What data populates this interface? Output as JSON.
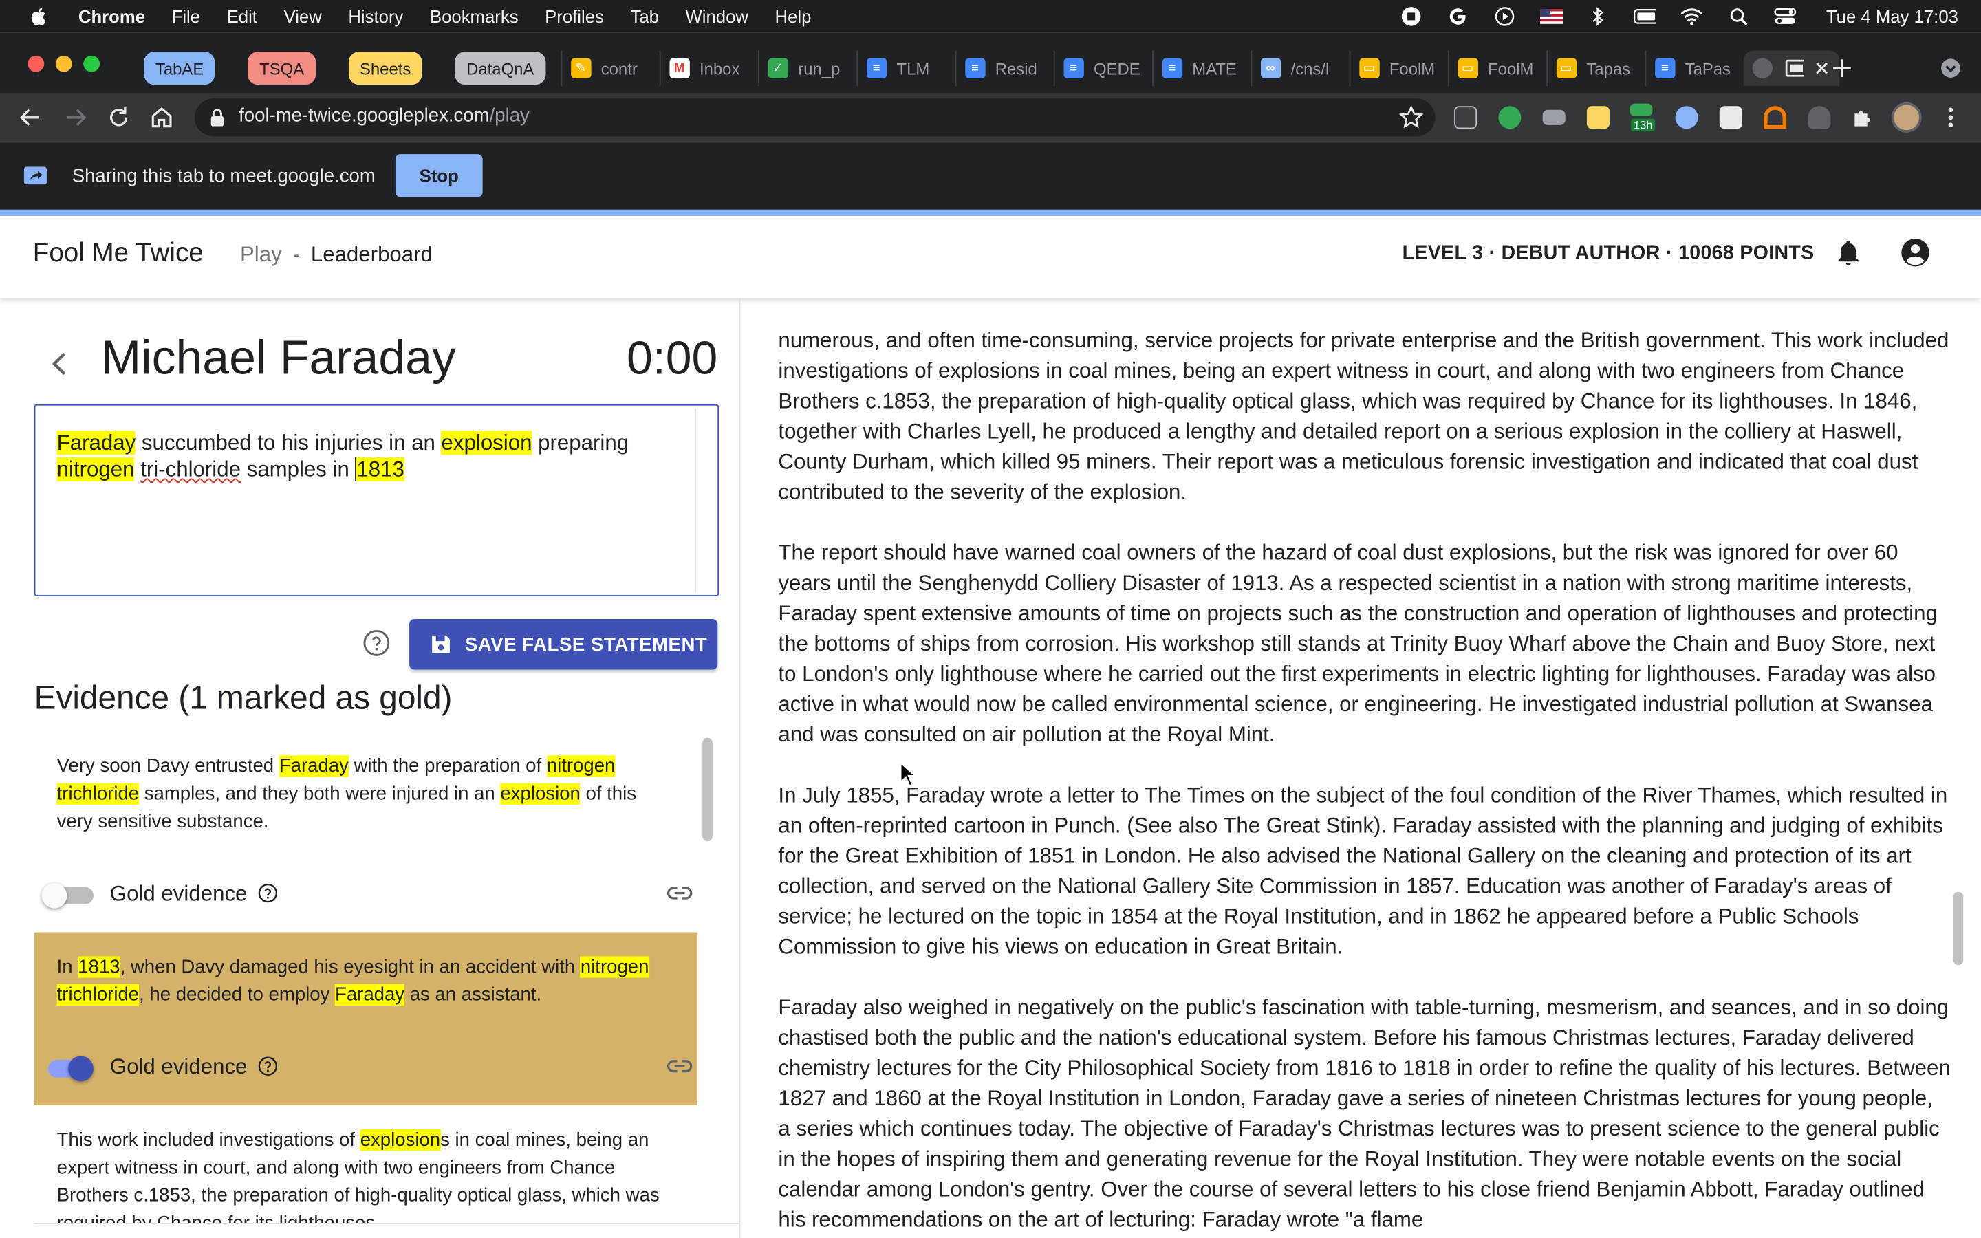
{
  "menubar": {
    "items": [
      "Chrome",
      "File",
      "Edit",
      "View",
      "History",
      "Bookmarks",
      "Profiles",
      "Tab",
      "Window",
      "Help"
    ],
    "clock": "Tue 4 May  17:03"
  },
  "tabs": {
    "pinned": [
      {
        "label": "TabAE",
        "color": "#8ab4f8"
      },
      {
        "label": "TSQA",
        "color": "#f28b82"
      },
      {
        "label": "Sheets",
        "color": "#fdd663"
      },
      {
        "label": "DataQnA",
        "color": "#bdc1c6"
      }
    ],
    "open": [
      {
        "label": "contr",
        "icon": "keep-icon",
        "color": "#fbbc04"
      },
      {
        "label": "Inbox",
        "icon": "gmail-icon",
        "color": "#ea4335"
      },
      {
        "label": "run_p",
        "icon": "check-icon",
        "color": "#34a853"
      },
      {
        "label": "TLM",
        "icon": "docs-icon",
        "color": "#4285f4"
      },
      {
        "label": "Resid",
        "icon": "docs-icon",
        "color": "#4285f4"
      },
      {
        "label": "QEDE",
        "icon": "docs-icon",
        "color": "#4285f4"
      },
      {
        "label": "MATE",
        "icon": "docs-icon",
        "color": "#4285f4"
      },
      {
        "label": "/cns/l",
        "icon": "cns-icon",
        "color": "#8ab4f8"
      },
      {
        "label": "FoolM",
        "icon": "slides-icon",
        "color": "#fbbc04"
      },
      {
        "label": "FoolM",
        "icon": "slides-icon",
        "color": "#fbbc04"
      },
      {
        "label": "Tapas",
        "icon": "slides-icon",
        "color": "#fbbc04"
      },
      {
        "label": "TaPas",
        "icon": "docs-icon",
        "color": "#4285f4"
      }
    ]
  },
  "toolbar": {
    "url_host": "fool-me-twice.googleplex.com",
    "url_path": "/play",
    "ext_badge": "13h"
  },
  "sharebar": {
    "text": "Sharing this tab to meet.google.com",
    "stop_label": "Stop"
  },
  "app": {
    "brand": "Fool Me Twice",
    "nav_play": "Play",
    "nav_sep": "-",
    "nav_leaderboard": "Leaderboard",
    "level": "LEVEL 3 · DEBUT AUTHOR · 10068 POINTS"
  },
  "game": {
    "title": "Michael Faraday",
    "timer": "0:00",
    "statement": [
      {
        "t": "Faraday",
        "hl": true
      },
      {
        "t": " succumbed to his injuries in an ",
        "hl": false
      },
      {
        "t": "explosion",
        "hl": true
      },
      {
        "t": " preparing ",
        "hl": false
      },
      {
        "t": "nitrogen",
        "hl": true
      },
      {
        "t": " ",
        "hl": false
      },
      {
        "t": "tri-chloride",
        "hl": false,
        "squiggle": true
      },
      {
        "t": " samples in ",
        "hl": false
      },
      {
        "t": "1813",
        "hl": true,
        "caret": true
      }
    ],
    "save_label": "SAVE FALSE STATEMENT",
    "evidence_title": "Evidence (1 marked as gold)",
    "gold_label": "Gold evidence",
    "evidence": [
      {
        "gold": false,
        "segments": [
          {
            "t": "Very soon Davy entrusted ",
            "hl": false
          },
          {
            "t": "Faraday",
            "hl": true
          },
          {
            "t": " with the preparation of ",
            "hl": false
          },
          {
            "t": "nitrogen trichloride",
            "hl": true
          },
          {
            "t": " samples, and they both were injured in an ",
            "hl": false
          },
          {
            "t": "explosion",
            "hl": true
          },
          {
            "t": " of this very sensitive substance.",
            "hl": false
          }
        ]
      },
      {
        "gold": true,
        "segments": [
          {
            "t": "In ",
            "hl": false
          },
          {
            "t": "1813",
            "hl": true
          },
          {
            "t": ", when Davy damaged his eyesight in an accident with ",
            "hl": false
          },
          {
            "t": "nitrogen trichloride",
            "hl": true
          },
          {
            "t": ", he decided to employ ",
            "hl": false
          },
          {
            "t": "Faraday",
            "hl": true
          },
          {
            "t": " as an assistant.",
            "hl": false
          }
        ]
      },
      {
        "gold": false,
        "segments": [
          {
            "t": "This work included investigations of ",
            "hl": false
          },
          {
            "t": "explosion",
            "hl": true
          },
          {
            "t": "s in coal mines, being an expert witness in court, and along with two engineers from Chance Brothers c.1853, the preparation of high-quality optical glass, which was required by Chance for its lighthouses.",
            "hl": false
          }
        ]
      }
    ]
  },
  "article": {
    "paragraphs": [
      "numerous, and often time-consuming, service projects for private enterprise and the British government. This work included investigations of explosions in coal mines, being an expert witness in court, and along with two engineers from Chance Brothers c.1853, the preparation of high-quality optical glass, which was required by Chance for its lighthouses. In 1846, together with Charles Lyell, he produced a lengthy and detailed report on a serious explosion in the colliery at Haswell, County Durham, which killed 95 miners. Their report was a meticulous forensic investigation and indicated that coal dust contributed to the severity of the explosion.",
      "The report should have warned coal owners of the hazard of coal dust explosions, but the risk was ignored for over 60 years until the Senghenydd Colliery Disaster of 1913. As a respected scientist in a nation with strong maritime interests, Faraday spent extensive amounts of time on projects such as the construction and operation of lighthouses and protecting the bottoms of ships from corrosion. His workshop still stands at Trinity Buoy Wharf above the Chain and Buoy Store, next to London's only lighthouse where he carried out the first experiments in electric lighting for lighthouses. Faraday was also active in what would now be called environmental science, or engineering. He investigated industrial pollution at Swansea and was consulted on air pollution at the Royal Mint.",
      "In July 1855, Faraday wrote a letter to The Times on the subject of the foul condition of the River Thames, which resulted in an often-reprinted cartoon in Punch. (See also The Great Stink). Faraday assisted with the planning and judging of exhibits for the Great Exhibition of 1851 in London. He also advised the National Gallery on the cleaning and protection of its art collection, and served on the National Gallery Site Commission in 1857. Education was another of Faraday's areas of service; he lectured on the topic in 1854 at the Royal Institution, and in 1862 he appeared before a Public Schools Commission to give his views on education in Great Britain.",
      "Faraday also weighed in negatively on the public's fascination with table-turning, mesmerism, and seances, and in so doing chastised both the public and the nation's educational system. Before his famous Christmas lectures, Faraday delivered chemistry lectures for the City Philosophical Society from 1816 to 1818 in order to refine the quality of his lectures. Between 1827 and 1860 at the Royal Institution in London, Faraday gave a series of nineteen Christmas lectures for young people, a series which continues today. The objective of Faraday's Christmas lectures was to present science to the general public in the hopes of inspiring them and generating revenue for the Royal Institution. They were notable events on the social calendar among London's gentry. Over the course of several letters to his close friend Benjamin Abbott, Faraday outlined his recommendations on the art of lecturing: Faraday wrote \"a flame"
    ]
  },
  "colors": {
    "accent": "#3f51b5",
    "highlight": "#ffff00",
    "gold_card": "#d4b26a",
    "toggle_on": "#3f51b5"
  }
}
